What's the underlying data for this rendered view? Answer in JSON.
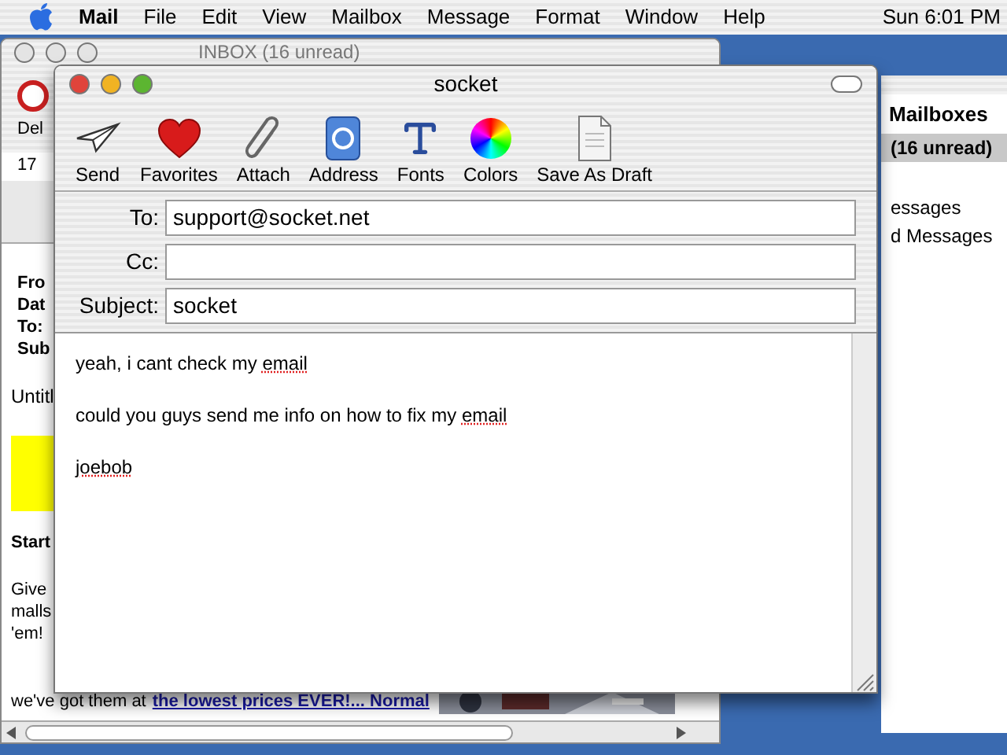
{
  "menu_bar": {
    "app": "Mail",
    "items": [
      "File",
      "Edit",
      "View",
      "Mailbox",
      "Message",
      "Format",
      "Window",
      "Help"
    ],
    "clock": "Sun 6:01 PM"
  },
  "inbox_window": {
    "title": "INBOX (16 unread)",
    "toolbar_label": "Del",
    "message_count": "17",
    "header_labels": [
      "Fro",
      "Dat",
      "To:",
      "Sub"
    ],
    "body_lines": [
      "Untitl",
      "Start",
      "Give",
      "malls",
      "'em!"
    ],
    "last_line": {
      "text": "we've got them at",
      "link": "the lowest prices EVER!... Normal"
    }
  },
  "mailboxes_drawer": {
    "title": "Mailboxes",
    "items": [
      {
        "label": "(16 unread)",
        "selected": true
      },
      {
        "label": "essages",
        "selected": false
      },
      {
        "label": "d Messages",
        "selected": false
      }
    ]
  },
  "compose_window": {
    "title": "socket",
    "toolbar": [
      {
        "kind": "send",
        "label": "Send"
      },
      {
        "kind": "favorites",
        "label": "Favorites"
      },
      {
        "kind": "attach",
        "label": "Attach"
      },
      {
        "kind": "address",
        "label": "Address"
      },
      {
        "kind": "fonts",
        "label": "Fonts"
      },
      {
        "kind": "colors",
        "label": "Colors"
      },
      {
        "kind": "draft",
        "label": "Save As Draft"
      }
    ],
    "fields": [
      {
        "label": "To:",
        "value": "support@socket.net"
      },
      {
        "label": "Cc:"
      },
      {
        "label": "Subject:",
        "value": "socket"
      }
    ],
    "body": [
      {
        "text": "yeah, i cant check my",
        "flagged": "email"
      },
      {
        "text": "could you guys send me info on how to fix my",
        "flagged": "email"
      },
      {
        "flagged": "joebob"
      }
    ]
  }
}
